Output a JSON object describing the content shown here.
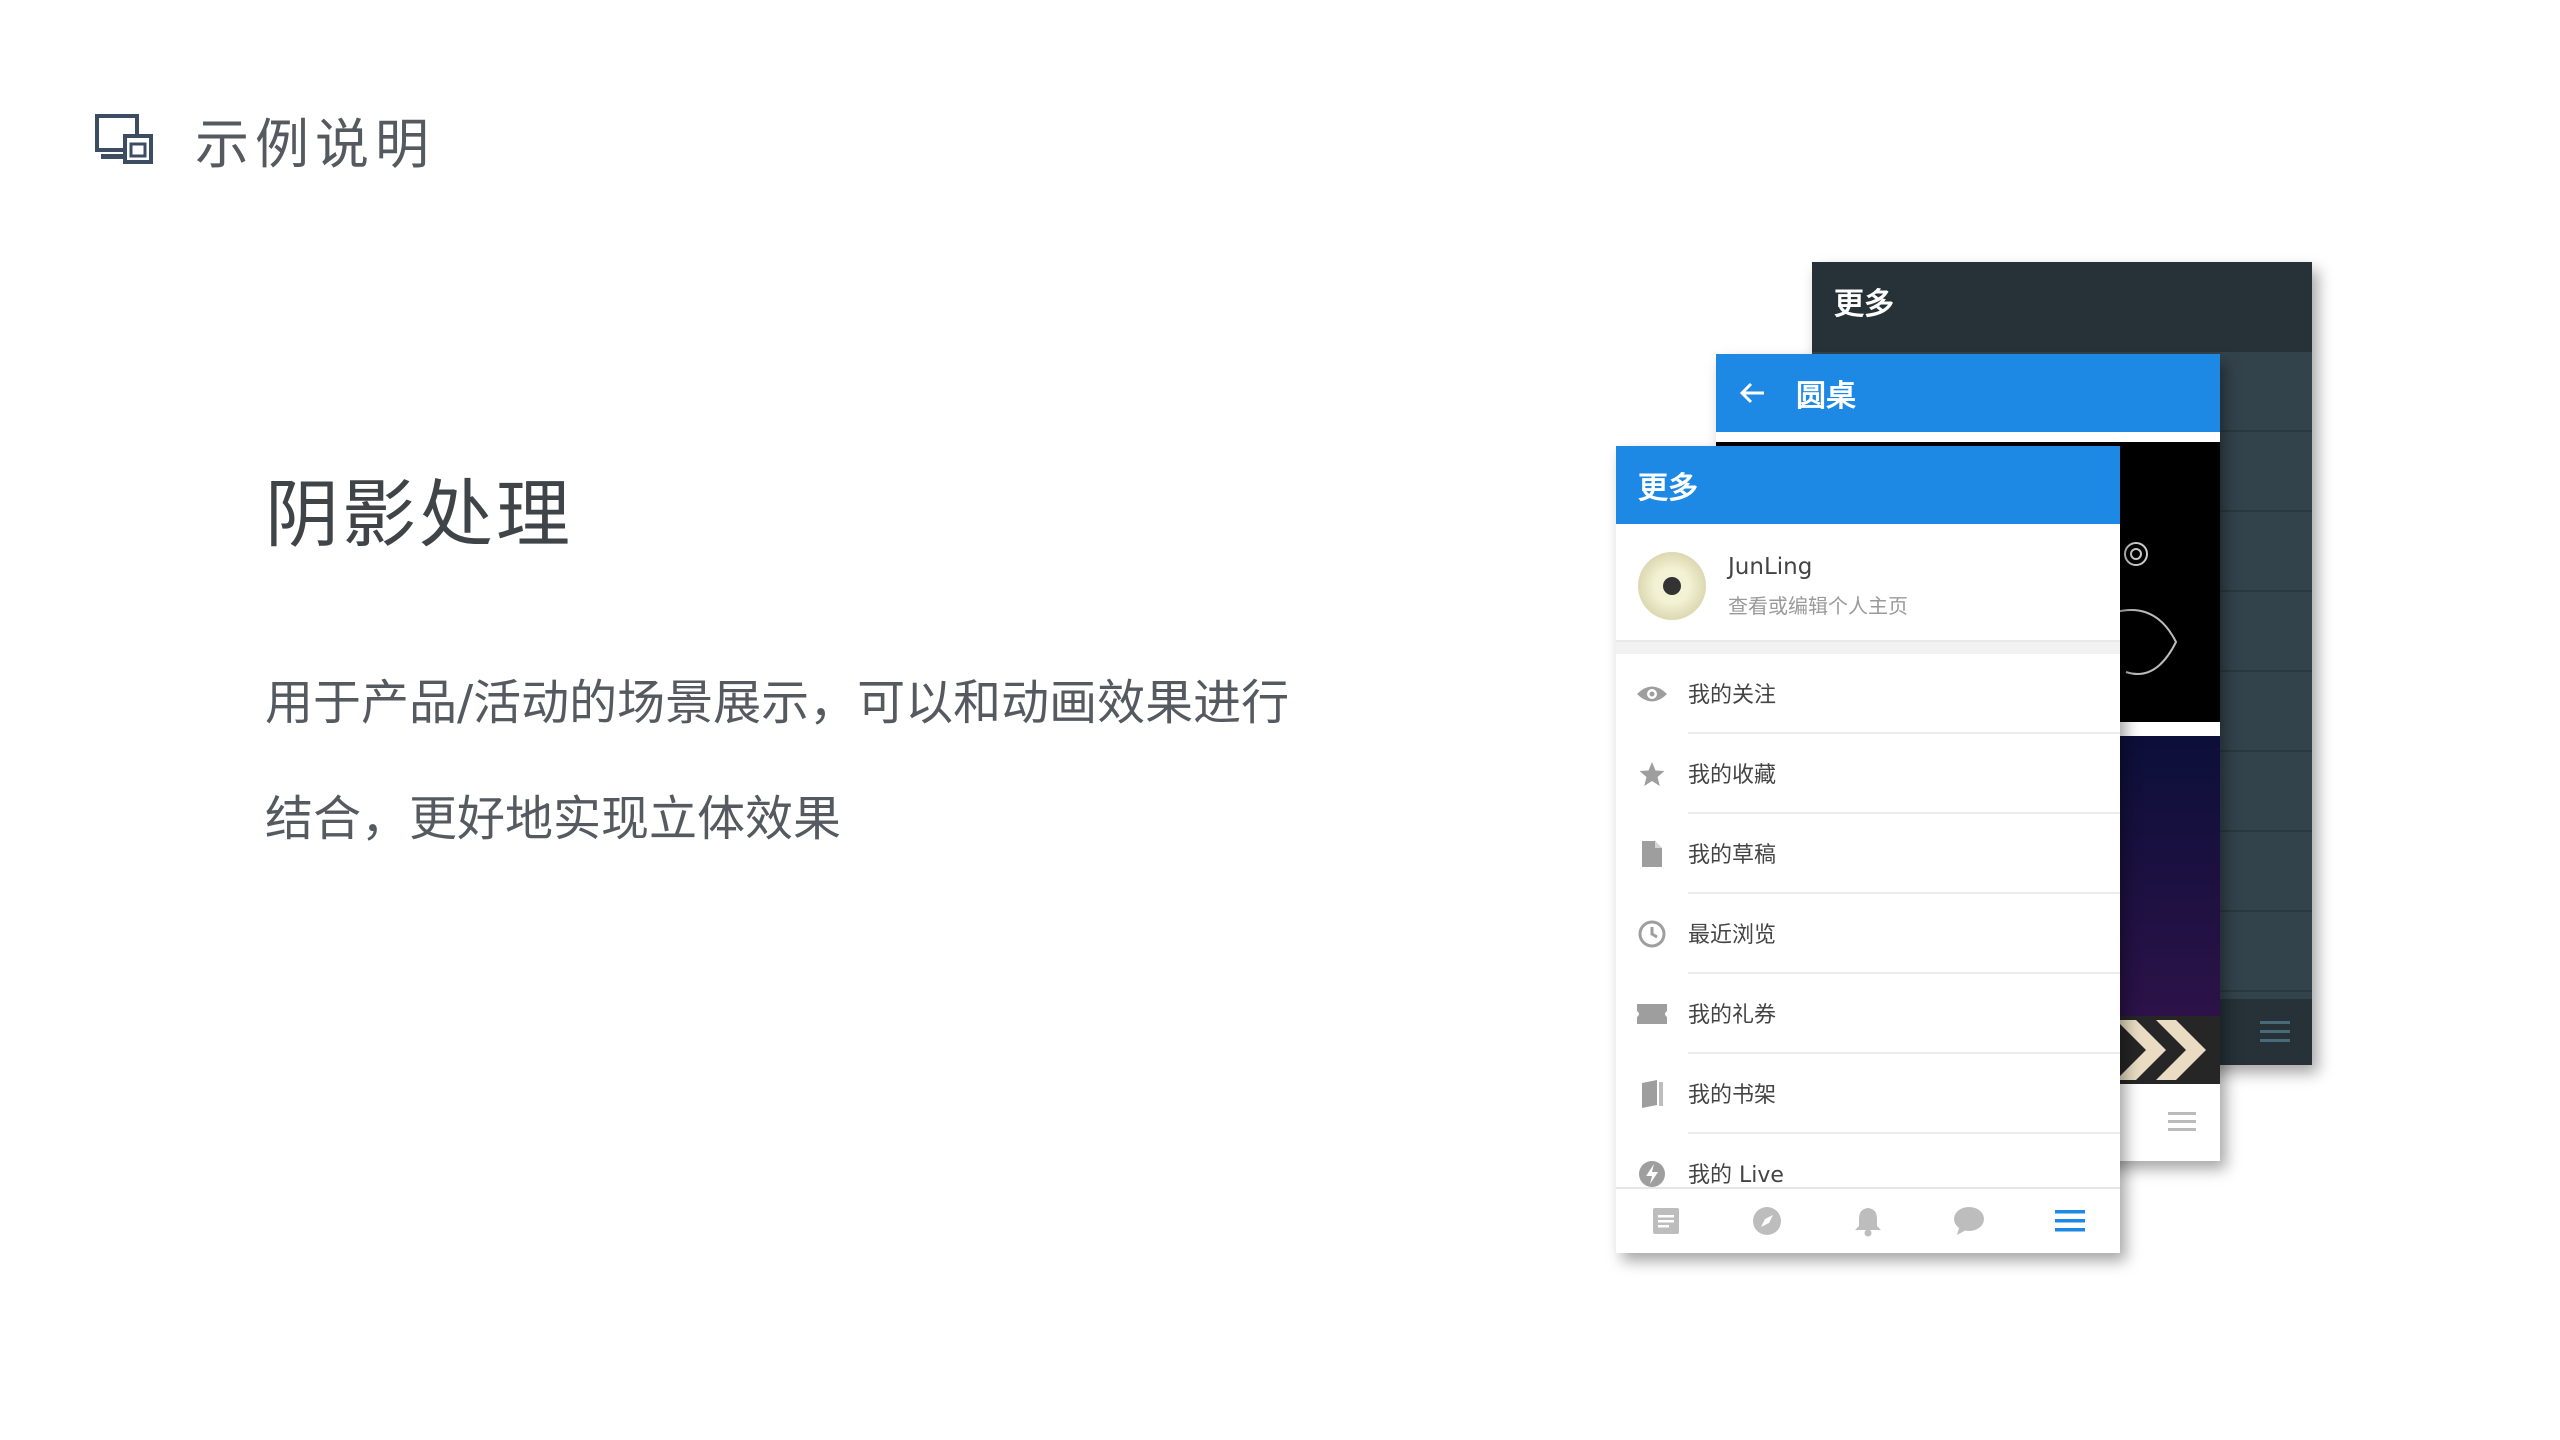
{
  "slide": {
    "title": "示例说明",
    "heading": "阴影处理",
    "description": "用于产品/活动的场景展示，可以和动画效果进行结合，更好地实现立体效果"
  },
  "colors": {
    "accent": "#1e88e5",
    "dark_bar": "#263238",
    "text": "#555a60"
  },
  "phones": {
    "back": {
      "title": "更多"
    },
    "middle": {
      "title": "圆桌",
      "back_icon": "arrow-left-icon"
    },
    "front": {
      "title": "更多",
      "profile": {
        "name": "JunLing",
        "subtitle": "查看或编辑个人主页"
      },
      "menu": [
        {
          "label": "我的关注",
          "icon": "eye-icon"
        },
        {
          "label": "我的收藏",
          "icon": "star-icon"
        },
        {
          "label": "我的草稿",
          "icon": "document-icon"
        },
        {
          "label": "最近浏览",
          "icon": "clock-icon"
        },
        {
          "label": "我的礼券",
          "icon": "ticket-icon"
        },
        {
          "label": "我的书架",
          "icon": "book-icon"
        },
        {
          "label": "我的 Live",
          "icon": "lightning-icon"
        }
      ],
      "tabs": [
        "feed-icon",
        "compass-icon",
        "bell-icon",
        "chat-icon",
        "menu-icon"
      ]
    }
  }
}
